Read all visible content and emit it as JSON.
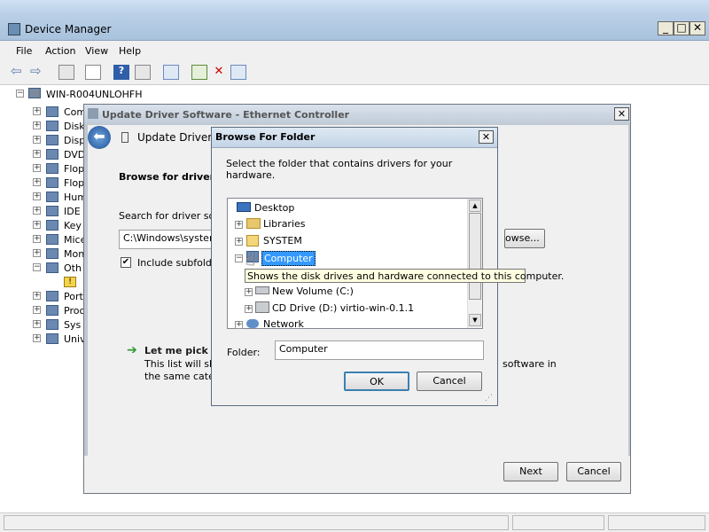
{
  "window": {
    "title": "Device Manager",
    "min": "_",
    "max": "□",
    "close": "✕"
  },
  "menu": [
    "File",
    "Action",
    "View",
    "Help"
  ],
  "tree": {
    "root": "WIN-R004UNLOHFH",
    "items": [
      "Com",
      "Disk",
      "Disp",
      "DVD",
      "Flop",
      "Flop",
      "Hum",
      "IDE",
      "Key",
      "Mice",
      "Mon",
      "Oth",
      "",
      "Port",
      "Proc",
      "Sys",
      "Univ"
    ]
  },
  "update_driver": {
    "title": "Update Driver Software - Ethernet Controller",
    "header": "Update Driver",
    "browse_label": "Browse for driver s",
    "search_label": "Search for driver sof",
    "path_value": "C:\\Windows\\syster",
    "include_subfolders": "Include subfolde",
    "browse_button": "owse...",
    "let_me_pick": "Let me pick fr",
    "list_text_1": "This list will show",
    "list_text_2": "the same categ",
    "list_text_right": "software in",
    "next": "Next",
    "cancel": "Cancel"
  },
  "browse_folder": {
    "title": "Browse For Folder",
    "instruction": "Select the folder that contains drivers for your hardware.",
    "items": {
      "desktop": "Desktop",
      "libraries": "Libraries",
      "system": "SYSTEM",
      "computer": "Computer",
      "new_volume": "New Volume (C:)",
      "cd_drive": "CD Drive (D:) virtio-win-0.1.1",
      "network": "Network"
    },
    "folder_label": "Folder:",
    "folder_value": "Computer",
    "ok": "OK",
    "cancel": "Cancel",
    "tooltip": "Shows the disk drives and hardware connected to this computer."
  }
}
